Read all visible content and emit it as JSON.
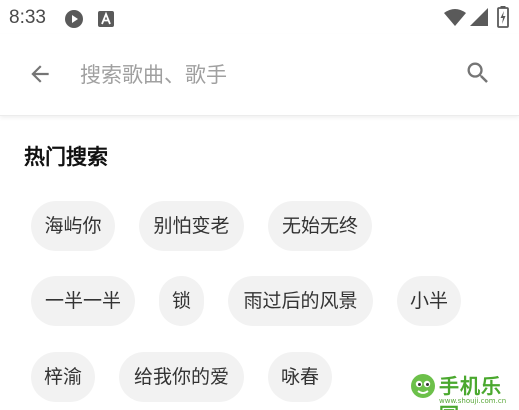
{
  "status_bar": {
    "time": "8:33",
    "icons": [
      "play-circle-icon",
      "a-box-icon",
      "wifi-icon",
      "signal-icon",
      "battery-charging-icon"
    ]
  },
  "search": {
    "placeholder": "搜索歌曲、歌手",
    "value": "",
    "back_icon": "arrow-left-icon",
    "search_icon": "search-icon"
  },
  "hot_search": {
    "title": "热门搜索",
    "rows": [
      [
        "海屿你",
        "别怕变老",
        "无始无终"
      ],
      [
        "一半一半",
        "锁",
        "雨过后的风景",
        "小半"
      ],
      [
        "梓渝",
        "给我你的爱",
        "咏春"
      ]
    ]
  },
  "watermark": {
    "text": "手机乐园",
    "url": "www.shouji.com.cn"
  },
  "colors": {
    "chip_bg": "#f2f2f2",
    "icon_gray": "#757575",
    "watermark_green": "#4aa82e"
  }
}
